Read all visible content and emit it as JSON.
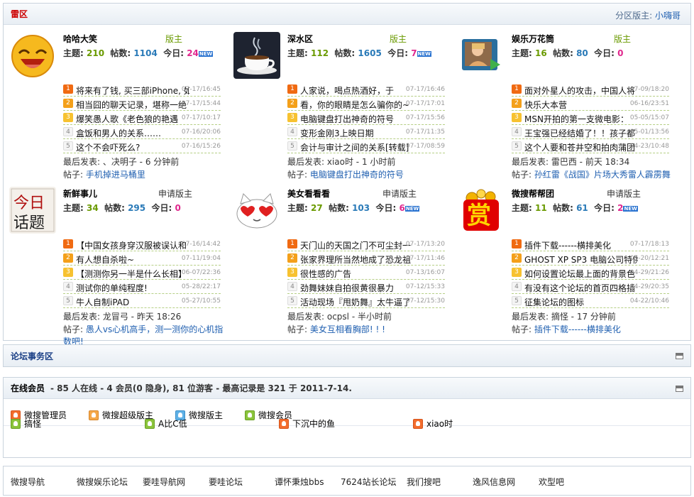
{
  "section": {
    "title": "雷区",
    "mod_label": "分区版主:",
    "mod_name": "小嗨哥"
  },
  "forums": [
    {
      "name": "哈哈大笑",
      "mod_label": "版主",
      "topics_label": "主题:",
      "topics": "210",
      "posts_label": "帖数:",
      "posts": "1104",
      "today_label": "今日:",
      "today": "24",
      "new": "NEW",
      "icon": "laughing-face-icon",
      "threads": [
        [
          "将来有了钱, 买三部iPhone, 如",
          "07-17/16:45"
        ],
        [
          "相当囧的聊天记录，堪称一绝",
          "07-17/15:44"
        ],
        [
          "爆笑愚人歌《老色狼的艳遇",
          "07-17/10:17"
        ],
        [
          "盒饭和男人的关系……",
          "07-16/20:06"
        ],
        [
          "这个不会吓死么?",
          "07-16/15:26"
        ]
      ],
      "last": "最后发表: 、决明子 - 6 分钟前",
      "topic_label": "帖子:",
      "topic": "手机掉进马桶里"
    },
    {
      "name": "深水区",
      "mod_label": "版主",
      "topics_label": "主题:",
      "topics": "112",
      "posts_label": "帖数:",
      "posts": "1605",
      "today_label": "今日:",
      "today": "7",
      "new": "NEW",
      "icon": "coffee-cup-icon",
      "threads": [
        [
          "人家说，喝点热酒好，于",
          "07-17/16:46"
        ],
        [
          "看，你的眼睛是怎么骗你的~",
          "07-17/17:01"
        ],
        [
          "电脑键盘打出神奇的符号",
          "07-17/15:56"
        ],
        [
          "变形金刚3上映日期",
          "07-17/11:35"
        ],
        [
          "会计与审计之间的关系[转载]",
          "07-17/08:59"
        ]
      ],
      "last": "最后发表: xiao时 - 1 小时前",
      "topic_label": "帖子:",
      "topic": "电脑键盘打出神奇的符号"
    },
    {
      "name": "娱乐万花筒",
      "mod_label": "版主",
      "topics_label": "主题:",
      "topics": "16",
      "posts_label": "帖数:",
      "posts": "80",
      "today_label": "今日:",
      "today": "0",
      "new": "",
      "icon": "media-player-icon",
      "threads": [
        [
          "面对外星人的攻击，中国人将",
          "07-09/18:20"
        ],
        [
          "快乐大本营",
          "06-16/23:51"
        ],
        [
          "MSN开拍的第一支微电影：",
          "05-05/15:07"
        ],
        [
          "王宝强已经结婚了！！孩子都",
          "05-01/13:56"
        ],
        [
          "这个人要和苍井空和拍肉蒲团",
          "04-23/10:48"
        ]
      ],
      "last": "最后发表: 雷巴西 - 前天 18:34",
      "topic_label": "帖子:",
      "topic": "孙红雷《战国》片场大秀雷人霹雳舞"
    },
    {
      "name": "新鲜事儿",
      "mod_label": "申请版主",
      "topics_label": "主题:",
      "topics": "34",
      "posts_label": "帖数:",
      "posts": "295",
      "today_label": "今日:",
      "today": "0",
      "new": "",
      "icon": "today-topic-icon",
      "icon_text": [
        "今日",
        "话题"
      ],
      "threads": [
        [
          "【中国女孩身穿汉服被误认和",
          "07-16/14:42"
        ],
        [
          "有人想自杀啦~",
          "07-11/19:04"
        ],
        [
          "【测测你另一半是什么长相】",
          "06-07/22:36"
        ],
        [
          "测试你的单纯程度!",
          "05-28/22:17"
        ],
        [
          "牛人自制iPAD",
          "05-27/10:55"
        ]
      ],
      "last": "最后发表: 龙冒弓 - 昨天 18:26",
      "topic_label": "帖子:",
      "topic": "愚人vs心机高手，测一测你的心机指数吧!"
    },
    {
      "name": "美女看看看",
      "mod_label": "申请版主",
      "topics_label": "主题:",
      "topics": "27",
      "posts_label": "帖数:",
      "posts": "103",
      "today_label": "今日:",
      "today": "6",
      "new": "NEW",
      "icon": "heart-eyes-cat-icon",
      "threads": [
        [
          "天门山的天国之门不可尘封一",
          "07-17/13:20"
        ],
        [
          "张家界理所当然地成了恐龙祖",
          "07-17/11:46"
        ],
        [
          "很性感的广告",
          "07-13/16:07"
        ],
        [
          "劲舞妹妹自拍很黄很暴力",
          "07-12/15:33"
        ],
        [
          "活动现场『甩奶舞』太牛逼了",
          "07-12/15:30"
        ]
      ],
      "last": "最后发表: ocpsl - 半小时前",
      "topic_label": "帖子:",
      "topic": "美女互相看胸部! ! !"
    },
    {
      "name": "微搜帮帮团",
      "mod_label": "申请版主",
      "topics_label": "主题:",
      "topics": "11",
      "posts_label": "帖数:",
      "posts": "61",
      "today_label": "今日:",
      "today": "2",
      "new": "NEW",
      "icon": "reward-coins-icon",
      "icon_text": [
        "赏"
      ],
      "threads": [
        [
          "插件下载------横排美化",
          "07-17/18:13"
        ],
        [
          "GHOST XP SP3 电脑公司特供",
          "05-20/12:21"
        ],
        [
          "如何设置论坛最上面的背景色",
          "04-29/21:26"
        ],
        [
          "有没有这个论坛的首页四格插",
          "04-29/20:35"
        ],
        [
          "征集论坛的图标",
          "04-22/10:46"
        ]
      ],
      "last": "最后发表: 摘怪 - 17 分钟前",
      "topic_label": "帖子:",
      "topic": "插件下载------横排美化"
    }
  ],
  "affairs": {
    "title": "论坛事务区"
  },
  "online": {
    "title": "在线会员",
    "summary": "- 85 人在线 - 4 会员(0 隐身), 81 位游客 - 最高记录是 321 于 2011-7-14.",
    "legend": [
      "微搜管理员",
      "微搜超级版主",
      "微搜版主",
      "微搜会员"
    ],
    "users": [
      "搞怪",
      "A比C低",
      "下沉中的鱼",
      "xiao时"
    ]
  },
  "footer_links": [
    "微搜导航",
    "微搜娱乐论坛",
    "要哇导航网",
    "要哇论坛",
    "谭怀秉烛bbs",
    "7624站长论坛",
    "我们搜吧",
    "逸风信息网",
    "欢型吧"
  ]
}
